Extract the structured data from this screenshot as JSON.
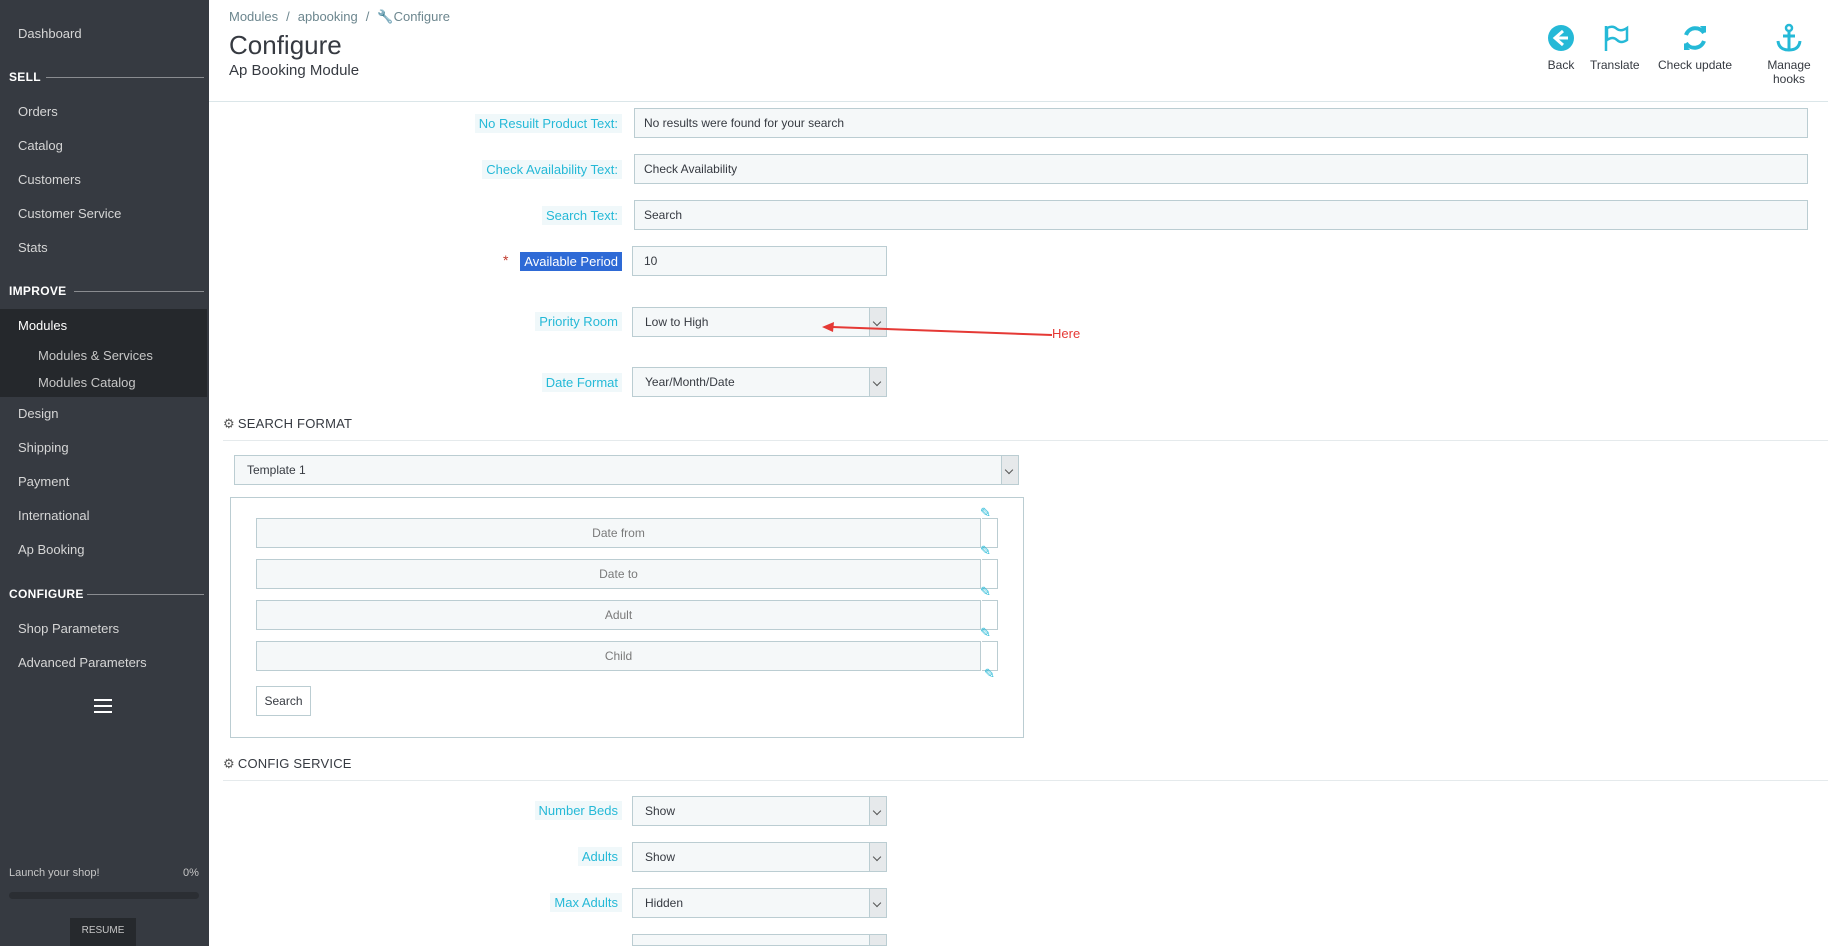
{
  "sidebar": {
    "dashboard": "Dashboard",
    "sell": "SELL",
    "orders": "Orders",
    "catalog": "Catalog",
    "customers": "Customers",
    "customer_service": "Customer Service",
    "stats": "Stats",
    "improve": "IMPROVE",
    "modules": "Modules",
    "modules_services": "Modules & Services",
    "modules_catalog": "Modules Catalog",
    "design": "Design",
    "shipping": "Shipping",
    "payment": "Payment",
    "international": "International",
    "ap_booking": "Ap Booking",
    "configure": "CONFIGURE",
    "shop_parameters": "Shop Parameters",
    "advanced_parameters": "Advanced Parameters",
    "launch": "Launch your shop!",
    "launch_pct": "0%",
    "resume": "RESUME"
  },
  "breadcrumb": {
    "b1": "Modules",
    "b2": "apbooking",
    "b3": "Configure",
    "sep": "/"
  },
  "header": {
    "title": "Configure",
    "subtitle": "Ap Booking Module"
  },
  "toolbar": {
    "back": "Back",
    "translate": "Translate",
    "check_update": "Check update",
    "manage_hooks": "Manage hooks"
  },
  "form": {
    "no_result_label": "No Resuilt Product Text:",
    "no_result_value": "No results were found for your search",
    "check_avail_label": "Check Availability Text:",
    "check_avail_value": "Check Availability",
    "search_text_label": "Search Text:",
    "search_text_value": "Search",
    "required_mark": "*",
    "available_period_label": "Available Period",
    "available_period_value": "10",
    "priority_room_label": "Priority Room",
    "priority_room_value": "Low to High",
    "date_format_label": "Date Format",
    "date_format_value": "Year/Month/Date"
  },
  "annotation": {
    "text": "Here",
    "color": "#e53935"
  },
  "search_format": {
    "heading": "SEARCH FORMAT",
    "template_value": "Template 1",
    "fields": [
      "Date from",
      "Date to",
      "Adult",
      "Child"
    ],
    "search_button": "Search"
  },
  "config_service": {
    "heading": "CONFIG SERVICE",
    "number_beds_label": "Number Beds",
    "number_beds_value": "Show",
    "adults_label": "Adults",
    "adults_value": "Show",
    "max_adults_label": "Max Adults",
    "max_adults_value": "Hidden"
  },
  "colors": {
    "accent": "#25b9d7",
    "sidebar": "#363a41",
    "selection": "#2e6ad6"
  }
}
